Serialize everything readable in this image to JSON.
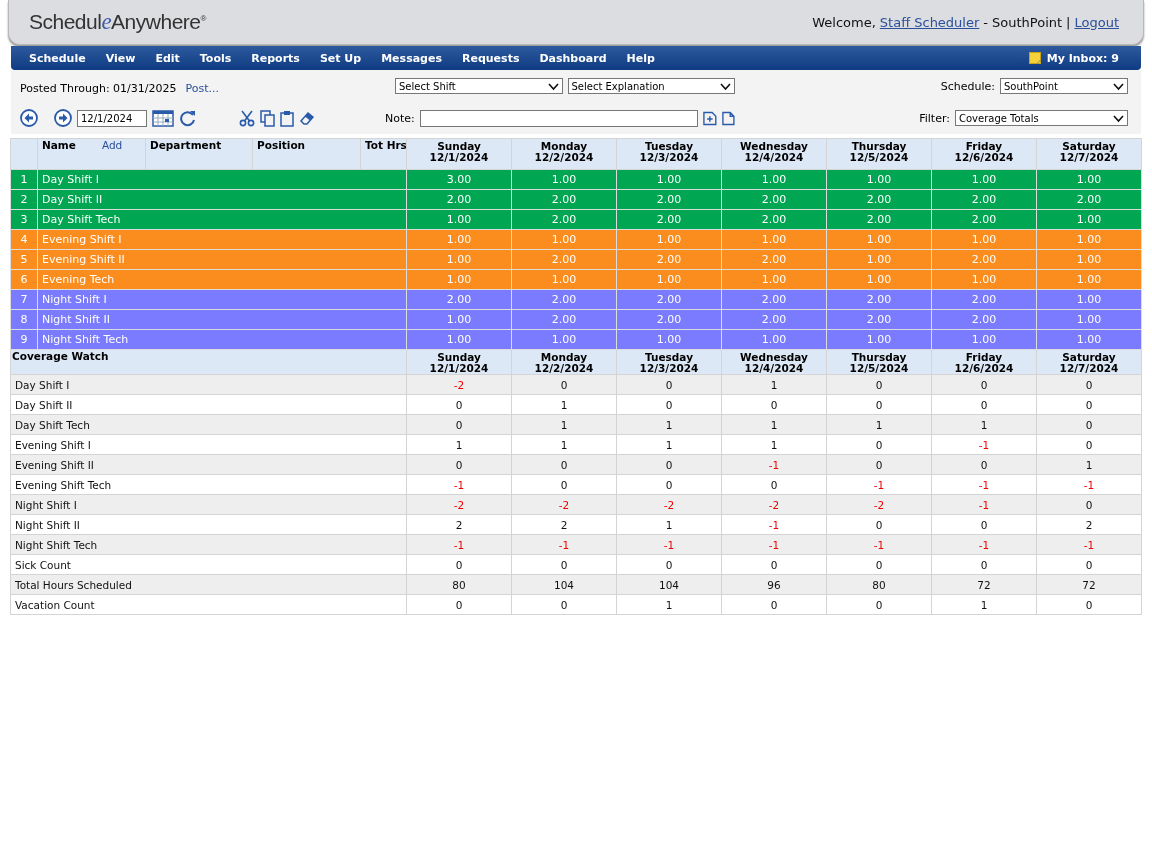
{
  "header": {
    "logo": {
      "lead": "Schedul",
      "accent": "e",
      "tail": "Anywhere",
      "mark": "®"
    },
    "greeting": "Welcome,",
    "user_link": "Staff Scheduler",
    "separator": "-",
    "site": "SouthPoint",
    "divider": "|",
    "logout": "Logout"
  },
  "nav": {
    "menu": [
      "Schedule",
      "View",
      "Edit",
      "Tools",
      "Reports",
      "Set Up",
      "Messages",
      "Requests",
      "Dashboard",
      "Help"
    ],
    "inbox": "My Inbox: 9"
  },
  "toolbar": {
    "posted": "Posted Through: 01/31/2025",
    "post_link": "Post...",
    "shift_select": "Select Shift",
    "explanation_select": "Select Explanation",
    "schedule_label": "Schedule:",
    "schedule_select": "SouthPoint",
    "date": "12/1/2024",
    "note_label": "Note:",
    "filter_label": "Filter:",
    "filter_select": "Coverage Totals"
  },
  "grid": {
    "columns": {
      "name": "Name",
      "add": "Add",
      "department": "Department",
      "position": "Position",
      "tot_hrs": "Tot Hrs"
    },
    "days": [
      {
        "day": "Sunday",
        "date": "12/1/2024"
      },
      {
        "day": "Monday",
        "date": "12/2/2024"
      },
      {
        "day": "Tuesday",
        "date": "12/3/2024"
      },
      {
        "day": "Wednesday",
        "date": "12/4/2024"
      },
      {
        "day": "Thursday",
        "date": "12/5/2024"
      },
      {
        "day": "Friday",
        "date": "12/6/2024"
      },
      {
        "day": "Saturday",
        "date": "12/7/2024"
      }
    ],
    "shift_rows": [
      {
        "num": "1",
        "name": "Day Shift I",
        "color": "#00a651",
        "values": [
          "3.00",
          "1.00",
          "1.00",
          "1.00",
          "1.00",
          "1.00",
          "1.00"
        ]
      },
      {
        "num": "2",
        "name": "Day Shift II",
        "color": "#00a651",
        "values": [
          "2.00",
          "2.00",
          "2.00",
          "2.00",
          "2.00",
          "2.00",
          "2.00"
        ]
      },
      {
        "num": "3",
        "name": "Day Shift Tech",
        "color": "#00a651",
        "values": [
          "1.00",
          "2.00",
          "2.00",
          "2.00",
          "2.00",
          "2.00",
          "1.00"
        ]
      },
      {
        "num": "4",
        "name": "Evening Shift I",
        "color": "#fb8c1e",
        "values": [
          "1.00",
          "1.00",
          "1.00",
          "1.00",
          "1.00",
          "1.00",
          "1.00"
        ]
      },
      {
        "num": "5",
        "name": "Evening Shift II",
        "color": "#fb8c1e",
        "values": [
          "1.00",
          "2.00",
          "2.00",
          "2.00",
          "1.00",
          "2.00",
          "1.00"
        ]
      },
      {
        "num": "6",
        "name": "Evening Tech",
        "color": "#fb8c1e",
        "values": [
          "1.00",
          "1.00",
          "1.00",
          "1.00",
          "1.00",
          "1.00",
          "1.00"
        ]
      },
      {
        "num": "7",
        "name": "Night Shift I",
        "color": "#7b7bff",
        "values": [
          "2.00",
          "2.00",
          "2.00",
          "2.00",
          "2.00",
          "2.00",
          "1.00"
        ]
      },
      {
        "num": "8",
        "name": "Night Shift II",
        "color": "#7b7bff",
        "values": [
          "1.00",
          "2.00",
          "2.00",
          "2.00",
          "2.00",
          "2.00",
          "1.00"
        ]
      },
      {
        "num": "9",
        "name": "Night Shift Tech",
        "color": "#7b7bff",
        "values": [
          "1.00",
          "1.00",
          "1.00",
          "1.00",
          "1.00",
          "1.00",
          "1.00"
        ]
      }
    ],
    "coverage": {
      "title": "Coverage Watch",
      "days": [
        {
          "day": "Sunday",
          "date": "12/1/2024"
        },
        {
          "day": "Monday",
          "date": "12/2/2024"
        },
        {
          "day": "Tuesday",
          "date": "12/3/2024"
        },
        {
          "day": "Wednesday",
          "date": "12/4/2024"
        },
        {
          "day": "Thursday",
          "date": "12/5/2024"
        },
        {
          "day": "Friday",
          "date": "12/6/2024"
        },
        {
          "day": "Saturday",
          "date": "12/7/2024"
        }
      ],
      "rows": [
        {
          "label": "Day Shift I",
          "cells": [
            {
              "value": "-2",
              "short": true
            },
            {
              "value": "0",
              "short": false
            },
            {
              "value": "0",
              "short": false
            },
            {
              "value": "1",
              "short": false
            },
            {
              "value": "0",
              "short": false
            },
            {
              "value": "0",
              "short": false
            },
            {
              "value": "0",
              "short": false
            }
          ]
        },
        {
          "label": "Day Shift II",
          "cells": [
            {
              "value": "0",
              "short": false
            },
            {
              "value": "1",
              "short": false
            },
            {
              "value": "0",
              "short": false
            },
            {
              "value": "0",
              "short": false
            },
            {
              "value": "0",
              "short": false
            },
            {
              "value": "0",
              "short": false
            },
            {
              "value": "0",
              "short": false
            }
          ]
        },
        {
          "label": "Day Shift Tech",
          "cells": [
            {
              "value": "0",
              "short": false
            },
            {
              "value": "1",
              "short": false
            },
            {
              "value": "1",
              "short": false
            },
            {
              "value": "1",
              "short": false
            },
            {
              "value": "1",
              "short": false
            },
            {
              "value": "1",
              "short": false
            },
            {
              "value": "0",
              "short": false
            }
          ]
        },
        {
          "label": "Evening Shift I",
          "cells": [
            {
              "value": "1",
              "short": false
            },
            {
              "value": "1",
              "short": false
            },
            {
              "value": "1",
              "short": false
            },
            {
              "value": "1",
              "short": false
            },
            {
              "value": "0",
              "short": false
            },
            {
              "value": "-1",
              "short": true
            },
            {
              "value": "0",
              "short": false
            }
          ]
        },
        {
          "label": "Evening Shift II",
          "cells": [
            {
              "value": "0",
              "short": false
            },
            {
              "value": "0",
              "short": false
            },
            {
              "value": "0",
              "short": false
            },
            {
              "value": "-1",
              "short": true
            },
            {
              "value": "0",
              "short": false
            },
            {
              "value": "0",
              "short": false
            },
            {
              "value": "1",
              "short": false
            }
          ]
        },
        {
          "label": "Evening Shift Tech",
          "cells": [
            {
              "value": "-1",
              "short": true
            },
            {
              "value": "0",
              "short": false
            },
            {
              "value": "0",
              "short": false
            },
            {
              "value": "0",
              "short": false
            },
            {
              "value": "-1",
              "short": true
            },
            {
              "value": "-1",
              "short": true
            },
            {
              "value": "-1",
              "short": true
            }
          ]
        },
        {
          "label": "Night Shift I",
          "cells": [
            {
              "value": "-2",
              "short": true
            },
            {
              "value": "-2",
              "short": true
            },
            {
              "value": "-2",
              "short": true
            },
            {
              "value": "-2",
              "short": true
            },
            {
              "value": "-2",
              "short": true
            },
            {
              "value": "-1",
              "short": true
            },
            {
              "value": "0",
              "short": false
            }
          ]
        },
        {
          "label": "Night Shift II",
          "cells": [
            {
              "value": "2",
              "short": false
            },
            {
              "value": "2",
              "short": false
            },
            {
              "value": "1",
              "short": false
            },
            {
              "value": "-1",
              "short": true
            },
            {
              "value": "0",
              "short": false
            },
            {
              "value": "0",
              "short": false
            },
            {
              "value": "2",
              "short": false
            }
          ]
        },
        {
          "label": "Night Shift Tech",
          "cells": [
            {
              "value": "-1",
              "short": true
            },
            {
              "value": "-1",
              "short": true
            },
            {
              "value": "-1",
              "short": true
            },
            {
              "value": "-1",
              "short": true
            },
            {
              "value": "-1",
              "short": true
            },
            {
              "value": "-1",
              "short": true
            },
            {
              "value": "-1",
              "short": true
            }
          ]
        },
        {
          "label": "Sick Count",
          "cells": [
            {
              "value": "0",
              "short": false
            },
            {
              "value": "0",
              "short": false
            },
            {
              "value": "0",
              "short": false
            },
            {
              "value": "0",
              "short": false
            },
            {
              "value": "0",
              "short": false
            },
            {
              "value": "0",
              "short": false
            },
            {
              "value": "0",
              "short": false
            }
          ]
        },
        {
          "label": "Total Hours Scheduled",
          "cells": [
            {
              "value": "80",
              "short": false
            },
            {
              "value": "104",
              "short": false
            },
            {
              "value": "104",
              "short": false
            },
            {
              "value": "96",
              "short": false
            },
            {
              "value": "80",
              "short": false
            },
            {
              "value": "72",
              "short": false
            },
            {
              "value": "72",
              "short": false
            }
          ]
        },
        {
          "label": "Vacation Count",
          "cells": [
            {
              "value": "0",
              "short": false
            },
            {
              "value": "0",
              "short": false
            },
            {
              "value": "1",
              "short": false
            },
            {
              "value": "0",
              "short": false
            },
            {
              "value": "0",
              "short": false
            },
            {
              "value": "1",
              "short": false
            },
            {
              "value": "0",
              "short": false
            }
          ]
        }
      ]
    }
  }
}
